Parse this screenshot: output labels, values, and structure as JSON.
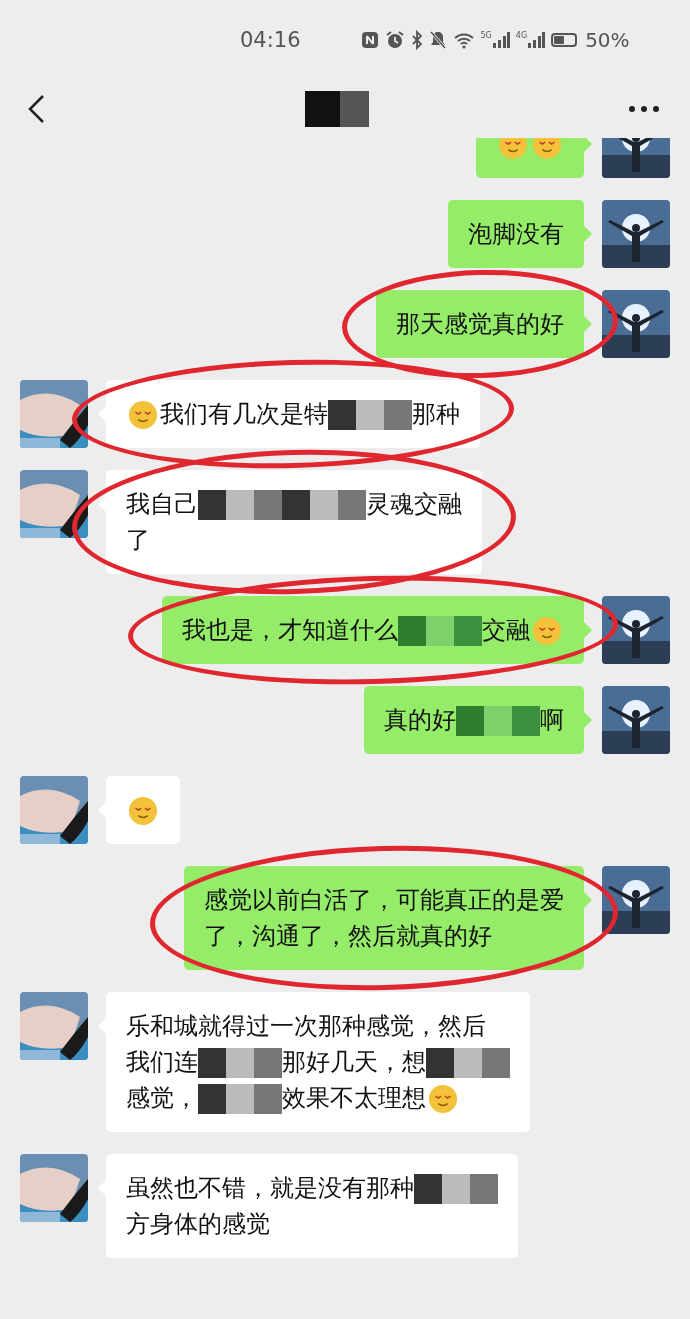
{
  "status_bar": {
    "time": "04:16",
    "network_labels": [
      "5G",
      "4G"
    ],
    "battery": "50%"
  },
  "nav": {
    "title_blurred": true
  },
  "messages": [
    {
      "kind": "outgoing",
      "circled": false,
      "parts": [
        {
          "kind": "emoji"
        },
        {
          "kind": "emoji"
        }
      ]
    },
    {
      "kind": "outgoing",
      "circled": false,
      "parts": [
        {
          "kind": "text",
          "text": "泡脚没有"
        }
      ]
    },
    {
      "kind": "outgoing",
      "circled": true,
      "parts": [
        {
          "kind": "text",
          "text": "那天感觉真的好"
        }
      ]
    },
    {
      "kind": "incoming",
      "circled": true,
      "parts": [
        {
          "kind": "emoji"
        },
        {
          "kind": "text",
          "text": "我们有几次是特"
        },
        {
          "kind": "mosaic"
        },
        {
          "kind": "text",
          "text": "那种"
        }
      ]
    },
    {
      "kind": "incoming",
      "circled": true,
      "parts": [
        {
          "kind": "text",
          "text": "我自己"
        },
        {
          "kind": "mosaic"
        },
        {
          "kind": "mosaic"
        },
        {
          "kind": "text",
          "text": "灵魂交融"
        },
        {
          "kind": "break"
        },
        {
          "kind": "text",
          "text": "了"
        }
      ]
    },
    {
      "kind": "outgoing",
      "circled": true,
      "parts": [
        {
          "kind": "text",
          "text": "我也是，才知道什么"
        },
        {
          "kind": "mosaic"
        },
        {
          "kind": "text",
          "text": "交融"
        },
        {
          "kind": "emoji"
        }
      ]
    },
    {
      "kind": "outgoing",
      "circled": false,
      "parts": [
        {
          "kind": "text",
          "text": "真的好"
        },
        {
          "kind": "mosaic"
        },
        {
          "kind": "text",
          "text": "啊"
        }
      ]
    },
    {
      "kind": "incoming",
      "circled": false,
      "parts": [
        {
          "kind": "emoji"
        }
      ]
    },
    {
      "kind": "outgoing",
      "circled": true,
      "parts": [
        {
          "kind": "text",
          "text": "感觉以前白活了，可能真正的是爱"
        },
        {
          "kind": "break"
        },
        {
          "kind": "text",
          "text": "了，沟通了，然后就真的好"
        }
      ]
    },
    {
      "kind": "incoming",
      "circled": false,
      "parts": [
        {
          "kind": "text",
          "text": "乐和城就得过一次那种感觉，然后"
        },
        {
          "kind": "break"
        },
        {
          "kind": "text",
          "text": "我们连"
        },
        {
          "kind": "mosaic"
        },
        {
          "kind": "text",
          "text": "那好几天，想"
        },
        {
          "kind": "mosaic"
        },
        {
          "kind": "break"
        },
        {
          "kind": "text",
          "text": "感觉，"
        },
        {
          "kind": "mosaic"
        },
        {
          "kind": "text",
          "text": "效果不太理想"
        },
        {
          "kind": "emoji"
        }
      ]
    },
    {
      "kind": "incoming",
      "circled": false,
      "parts": [
        {
          "kind": "text",
          "text": "虽然也不错，就是没有那种"
        },
        {
          "kind": "mosaic"
        },
        {
          "kind": "break"
        },
        {
          "kind": "text",
          "text": "方身体的感觉"
        }
      ]
    }
  ]
}
